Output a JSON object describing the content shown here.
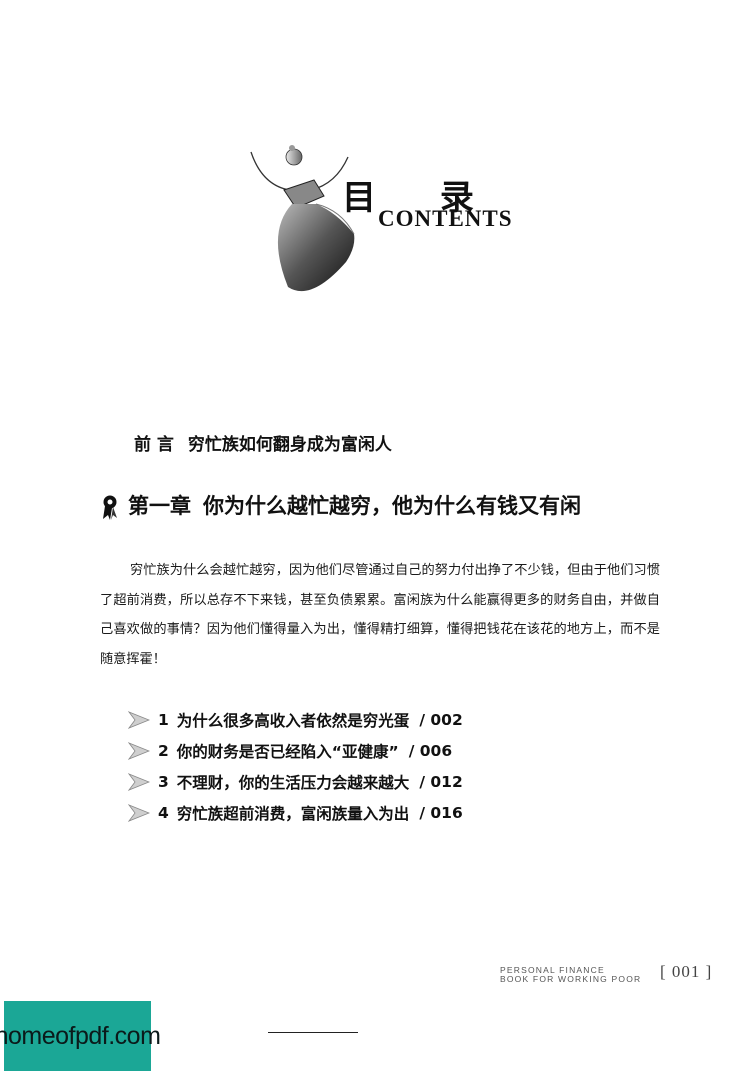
{
  "header": {
    "title_cn": "目 录",
    "title_en": "CONTENTS"
  },
  "preface": {
    "label": "前 言",
    "title": "穷忙族如何翻身成为富闲人"
  },
  "chapter": {
    "label": "第一章",
    "title": "你为什么越忙越穷，他为什么有钱又有闲",
    "icon": "ribbon-icon"
  },
  "description": "穷忙族为什么会越忙越穷，因为他们尽管通过自己的努力付出挣了不少钱，但由于他们习惯了超前消费，所以总存不下来钱，甚至负债累累。富闲族为什么能赢得更多的财务自由，并做自己喜欢做的事情？因为他们懂得量入为出，懂得精打细算，懂得把钱花在该花的地方上，而不是随意挥霍！",
  "toc": [
    {
      "num": "1",
      "title": "为什么很多高收入者依然是穷光蛋",
      "page": "/ 002"
    },
    {
      "num": "2",
      "title": "你的财务是否已经陷入“亚健康”",
      "page": "/ 006"
    },
    {
      "num": "3",
      "title": "不理财，你的生活压力会越来越大",
      "page": "/ 012"
    },
    {
      "num": "4",
      "title": "穷忙族超前消费，富闲族量入为出",
      "page": "/ 016"
    }
  ],
  "footer": {
    "line1": "PERSONAL FINANCE",
    "line2": "BOOK FOR WORKING POOR",
    "page": "[ 001 ]"
  },
  "watermark": "homeofpdf.com"
}
